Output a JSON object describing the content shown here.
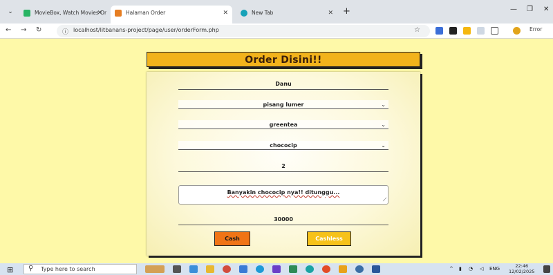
{
  "browser": {
    "tabs": [
      {
        "title": "MovieBox, Watch Movies Onlin"
      },
      {
        "title": "Halaman Order"
      },
      {
        "title": "New Tab"
      }
    ],
    "new_tab": "+",
    "url": "localhost/litbanans-project/page/user/orderForm.php",
    "error_label": "Error"
  },
  "page": {
    "header_title": "Order Disini!!",
    "form": {
      "name": "Danu",
      "food_select": "pisang lumer",
      "drink_select": "greentea",
      "topping_select": "chococip",
      "quantity": "2",
      "note": "Banyakin chococip nya!! ditunggu...",
      "total": "30000"
    },
    "buttons": {
      "cash": "Cash",
      "cashless": "Cashless"
    }
  },
  "taskbar": {
    "search_placeholder": "Type here to search",
    "language": "ENG",
    "time": "22:46",
    "date": "12/02/2025"
  },
  "icons": [
    "menu-chevron-icon",
    "moviebox-favicon",
    "halaman-favicon",
    "newtab-favicon",
    "back-icon",
    "forward-icon",
    "reload-icon",
    "info-icon",
    "star-icon",
    "windows-start-icon",
    "search-icon"
  ]
}
